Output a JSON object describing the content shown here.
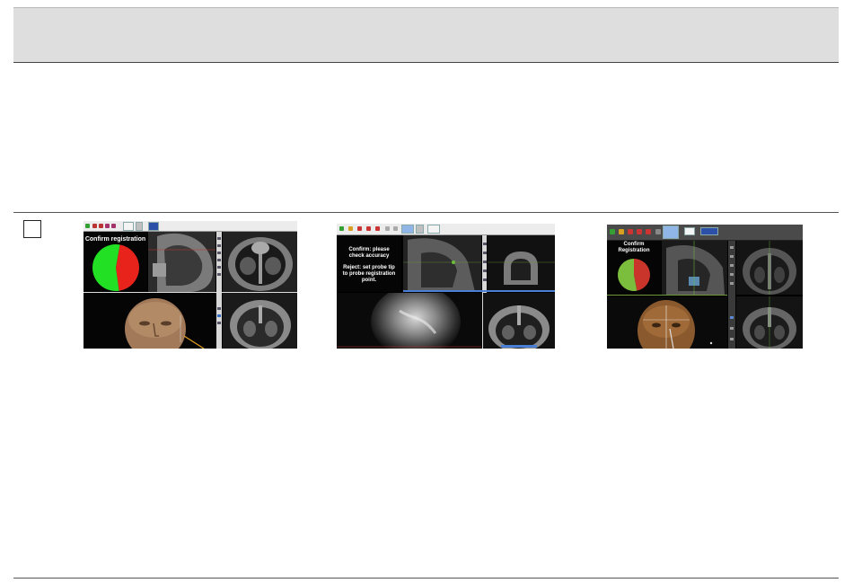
{
  "step": {
    "number": ""
  },
  "screenshots": [
    {
      "id": "shot1",
      "message": [
        "Confirm registration"
      ],
      "chart_data": {
        "type": "pie",
        "slices": [
          {
            "value": 45,
            "color": "#e8231b"
          },
          {
            "value": 55,
            "color": "#22e024"
          }
        ]
      }
    },
    {
      "id": "shot2",
      "message": [
        "Confirm: please",
        "check accuracy",
        "",
        "Reject: set probe tip",
        "to probe registration",
        "point."
      ]
    },
    {
      "id": "shot3",
      "message": [
        "Confirm",
        "Registration"
      ],
      "chart_data": {
        "type": "pie",
        "slices": [
          {
            "value": 47,
            "color": "#c9342b"
          },
          {
            "value": 53,
            "color": "#7bbd3c"
          }
        ]
      }
    }
  ],
  "colors": {
    "header_band": "#dedede",
    "rule": "#555555",
    "panel_bg": "#050505"
  }
}
